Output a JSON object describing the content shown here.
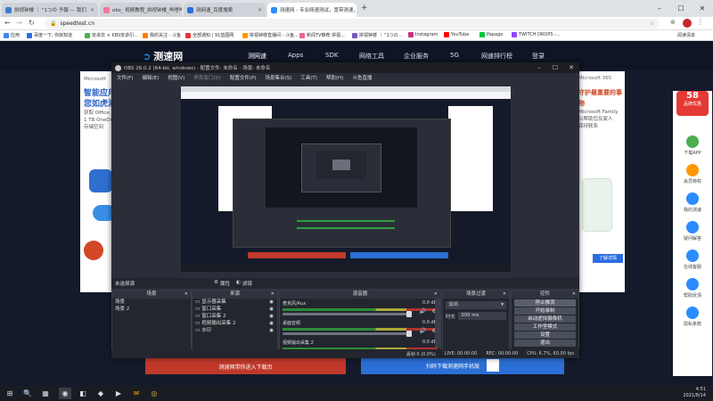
{
  "chrome": {
    "tabs": [
      {
        "label": "拼视钟楼 ｜ \"1つの 予報 — 我们",
        "color": "#3b7bd4"
      },
      {
        "label": "obs_ 视频教程_拼视钟楼_哔哩哔",
        "color": "#fb7299"
      },
      {
        "label": "测网速_百度搜索",
        "color": "#2b6de0"
      },
      {
        "label": "测速网 - 专业网速测试，宽带测速，…",
        "color": "#2b8cff"
      }
    ],
    "new_tab": "+",
    "url": "speedtest.cn",
    "bookmarks_label": "应用",
    "bookmarks": [
      {
        "label": "百度一下, 你就知道",
        "color": "#2b6de0"
      },
      {
        "label": "安卓非 × KBS安卓引...",
        "color": "#4caf50"
      },
      {
        "label": "我的关注 - 斗鱼",
        "color": "#ff7f00"
      },
      {
        "label": "全部通知 | 91蓝图网",
        "color": "#e53935"
      },
      {
        "label": "拼视钟楼直播间 - 斗鱼...",
        "color": "#ff9800"
      },
      {
        "label": "新闻TV推荐 拼视...",
        "color": "#f06292"
      },
      {
        "label": "拼视钟楼 ｜ \"1つの...",
        "color": "#7e57c2"
      },
      {
        "label": "Instagram",
        "color": "#c13584"
      },
      {
        "label": "YouTube",
        "color": "#ff0000"
      },
      {
        "label": "Papago",
        "color": "#00c73c"
      },
      {
        "label": "TWITCH DROPS -...",
        "color": "#9146ff"
      }
    ],
    "reading_list": "阅读清单"
  },
  "site": {
    "logo": "测速网",
    "nav": [
      "测网速",
      "Apps",
      "SDK",
      "网络工具",
      "企业服务",
      "5G",
      "网速排行榜"
    ],
    "login": "登录",
    "left_panel": {
      "brand": "Microsoft",
      "title_line1": "智能应用",
      "title_line2": "您如虎添翼",
      "sub_line1": "获取 Office 应用",
      "sub_line2": "1 TB OneDrive",
      "sub_line3": "存储空间"
    },
    "right_panel": {
      "brand": "Microsoft 365",
      "title_line1": "守护最重要的事物",
      "sub_line1": "Microsoft Family",
      "sub_line2": "以帮助您及家人",
      "sub_line3": "保持联系",
      "button": "了解详情"
    },
    "banner1": {
      "text": "测速网带你进入下载页"
    },
    "banner2": {
      "text": "扫码下载测速网手机版"
    },
    "sidebar": [
      {
        "label": "下载APP",
        "color": "#4caf50"
      },
      {
        "label": "会员特权",
        "color": "#ff9800"
      },
      {
        "label": "我的测速",
        "color": "#2b8cff"
      },
      {
        "label": "疑问解答",
        "color": "#2b8cff"
      },
      {
        "label": "在线客服",
        "color": "#2b8cff"
      },
      {
        "label": "帮助反馈",
        "color": "#2b8cff"
      },
      {
        "label": "隐私条款",
        "color": "#2b8cff"
      }
    ],
    "promo": {
      "label": "58",
      "sub": "品牌优惠"
    }
  },
  "obs": {
    "title": "OBS 26.0.2 (64-bit, windows) - 配置文件: 未命名 - 场景: 未命名",
    "menu": [
      "文件(F)",
      "编辑(E)",
      "视图(V)",
      "停靠窗口(D)",
      "配置文件(P)",
      "场景集合(S)",
      "工具(T)",
      "帮助(H)",
      "斗鱼直播"
    ],
    "source_label": "未选择源",
    "properties_btn": "属性",
    "filters_btn": "滤镜",
    "docks": {
      "scenes": {
        "title": "场景",
        "items": [
          "场景",
          "场景 2"
        ]
      },
      "sources": {
        "title": "来源",
        "items": [
          "显示器采集",
          "窗口采集",
          "窗口采集 2",
          "视频输出采集 2",
          "水印"
        ]
      },
      "mixer": {
        "title": "混音器",
        "channels": [
          {
            "name": "麦克风/Aux",
            "db": "0.0 dB"
          },
          {
            "name": "桌面音频",
            "db": "0.0 dB"
          },
          {
            "name": "视频输出采集 2",
            "db": "0.0 dB"
          },
          {
            "name": "桌面音频",
            "db": "0.0 dB"
          }
        ]
      },
      "transitions": {
        "title": "场景过渡",
        "type": "淡出",
        "duration_label": "时长",
        "duration": "300 ms"
      },
      "controls": {
        "title": "控件",
        "buttons": [
          "停止推流",
          "开始录制",
          "启动虚拟摄像机",
          "工作室模式",
          "设置",
          "退出"
        ]
      }
    },
    "status": {
      "live": "LIVE: 00:00:00",
      "rec": "REC: 00:00:00",
      "cpu": "CPU: 6.7%, 60.00 fps",
      "dropped": "丢帧 0 (0.0%)"
    }
  },
  "taskbar": {
    "time": "4:51",
    "date": "2021/8/14",
    "apps": [
      "⊞",
      "🔍",
      "▦",
      "◉",
      "◧",
      "◆",
      "▶",
      "✉",
      "◎"
    ]
  }
}
